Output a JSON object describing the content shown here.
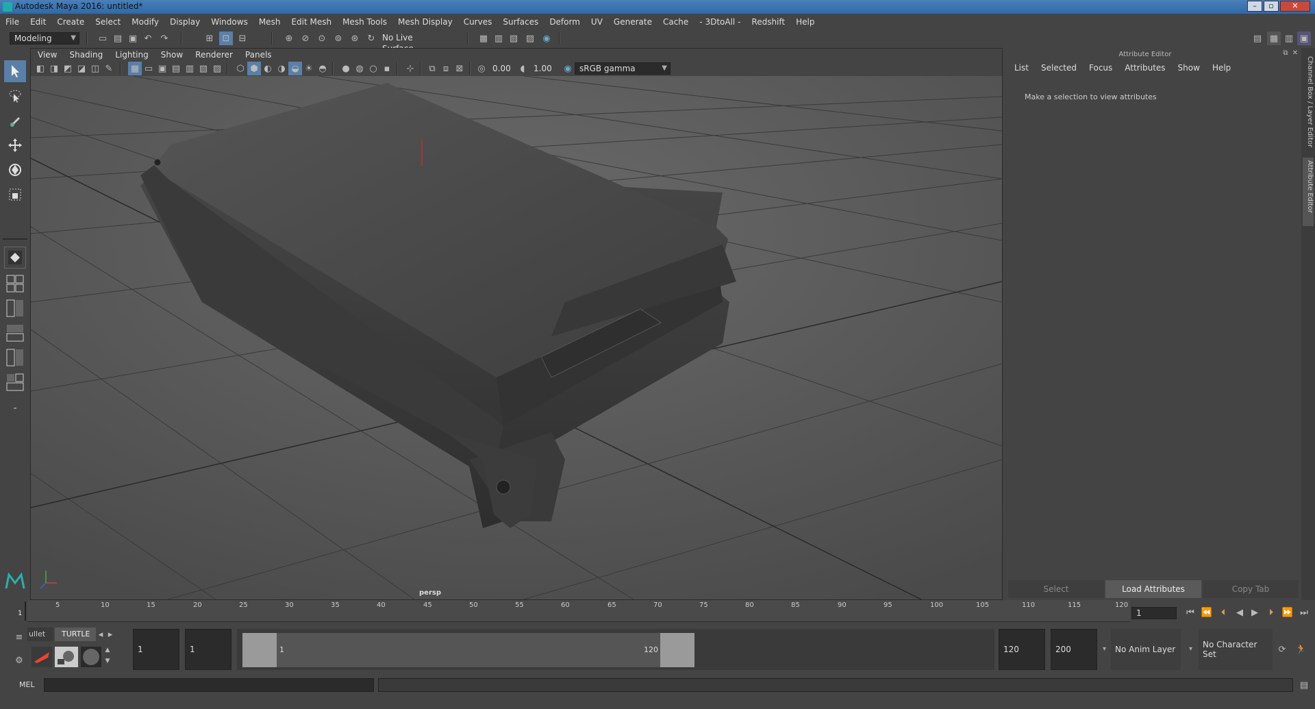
{
  "window": {
    "title": "Autodesk Maya 2016: untitled*"
  },
  "menubar": [
    "File",
    "Edit",
    "Create",
    "Select",
    "Modify",
    "Display",
    "Windows",
    "Mesh",
    "Edit Mesh",
    "Mesh Tools",
    "Mesh Display",
    "Curves",
    "Surfaces",
    "Deform",
    "UV",
    "Generate",
    "Cache",
    "- 3DtoAll -",
    "Redshift",
    "Help"
  ],
  "statusline": {
    "mode": "Modeling",
    "live_surface": "No Live Surface"
  },
  "viewport": {
    "menu": [
      "View",
      "Shading",
      "Lighting",
      "Show",
      "Renderer",
      "Panels"
    ],
    "exposure": "0.00",
    "gamma": "1.00",
    "color_space": "sRGB gamma",
    "camera_label": "persp"
  },
  "attribute_editor": {
    "title": "Attribute Editor",
    "menu": [
      "List",
      "Selected",
      "Focus",
      "Attributes",
      "Show",
      "Help"
    ],
    "message": "Make a selection to view attributes",
    "buttons": {
      "select": "Select",
      "load": "Load Attributes",
      "copy": "Copy Tab"
    },
    "side_tabs": [
      "Channel Box / Layer Editor",
      "Attribute Editor"
    ]
  },
  "timeline": {
    "ticks": [
      "5",
      "10",
      "15",
      "20",
      "25",
      "30",
      "35",
      "40",
      "45",
      "50",
      "55",
      "60",
      "65",
      "70",
      "75",
      "80",
      "85",
      "90",
      "95",
      "100",
      "105",
      "110",
      "115",
      "120"
    ],
    "current_marker": "1",
    "current_frame": "1"
  },
  "range": {
    "shelf_tabs": [
      "ullet",
      "TURTLE"
    ],
    "start": "1",
    "playback_start": "1",
    "slider_start": "1",
    "slider_end": "120",
    "playback_end": "120",
    "end": "200",
    "anim_layer": "No Anim Layer",
    "character_set": "No Character Set"
  },
  "cmdline": {
    "label": "MEL"
  }
}
